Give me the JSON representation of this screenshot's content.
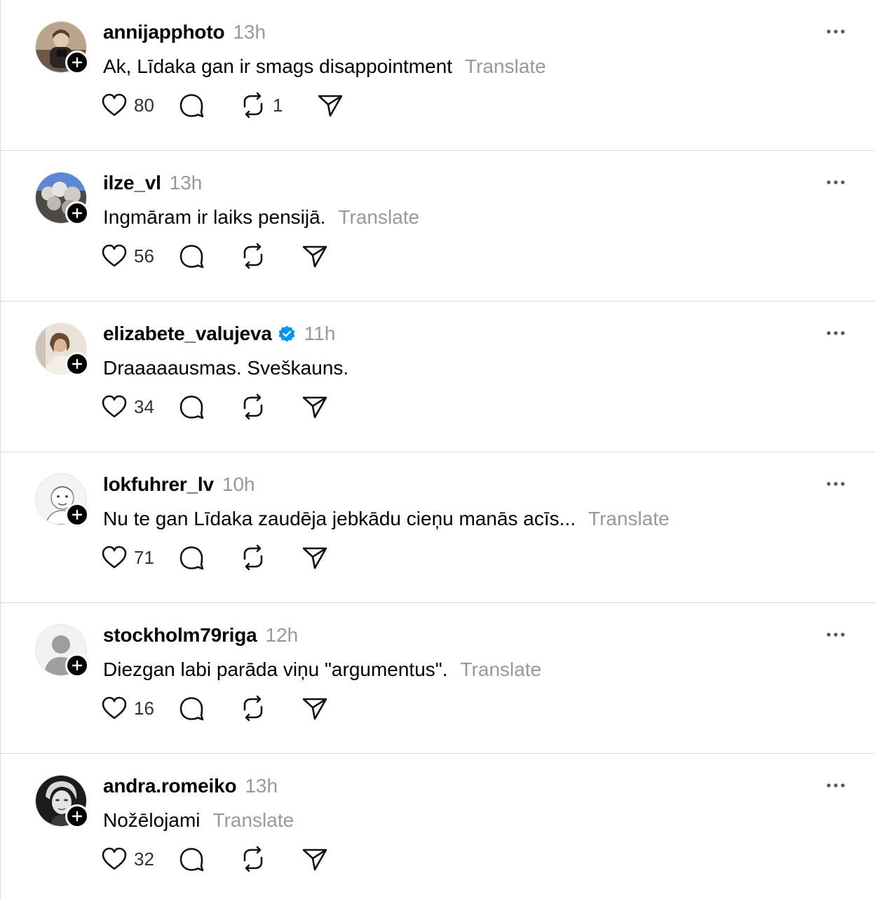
{
  "colors": {
    "text": "#000000",
    "muted": "#999999",
    "divider": "#d9d9d9",
    "verified": "#0095f6"
  },
  "actions": {
    "like_icon": "heart-icon",
    "reply_icon": "reply-bubble-icon",
    "repost_icon": "repost-icon",
    "share_icon": "send-icon",
    "more_icon": "more-horizontal-icon",
    "follow_icon": "plus-icon"
  },
  "posts": [
    {
      "username": "annijapphoto",
      "time": "13h",
      "text": "Ak, Līdaka gan ir smags disappointment",
      "translate": "Translate",
      "likes": "80",
      "reposts": "1",
      "verified": false
    },
    {
      "username": "ilze_vl",
      "time": "13h",
      "text": "Ingmāram ir laiks pensijā.",
      "translate": "Translate",
      "likes": "56",
      "reposts": "",
      "verified": false
    },
    {
      "username": "elizabete_valujeva",
      "time": "11h",
      "text": "Draaaaausmas. Sveškauns.",
      "translate": "",
      "likes": "34",
      "reposts": "",
      "verified": true
    },
    {
      "username": "lokfuhrer_lv",
      "time": "10h",
      "text": "Nu te gan Līdaka zaudēja jebkādu cieņu manās acīs...",
      "translate": "Translate",
      "likes": "71",
      "reposts": "",
      "verified": false
    },
    {
      "username": "stockholm79riga",
      "time": "12h",
      "text": "Diezgan labi parāda viņu \"argumentus\".",
      "translate": "Translate",
      "likes": "16",
      "reposts": "",
      "verified": false
    },
    {
      "username": "andra.romeiko",
      "time": "13h",
      "text": "Nožēlojami",
      "translate": "Translate",
      "likes": "32",
      "reposts": "",
      "verified": false
    }
  ]
}
